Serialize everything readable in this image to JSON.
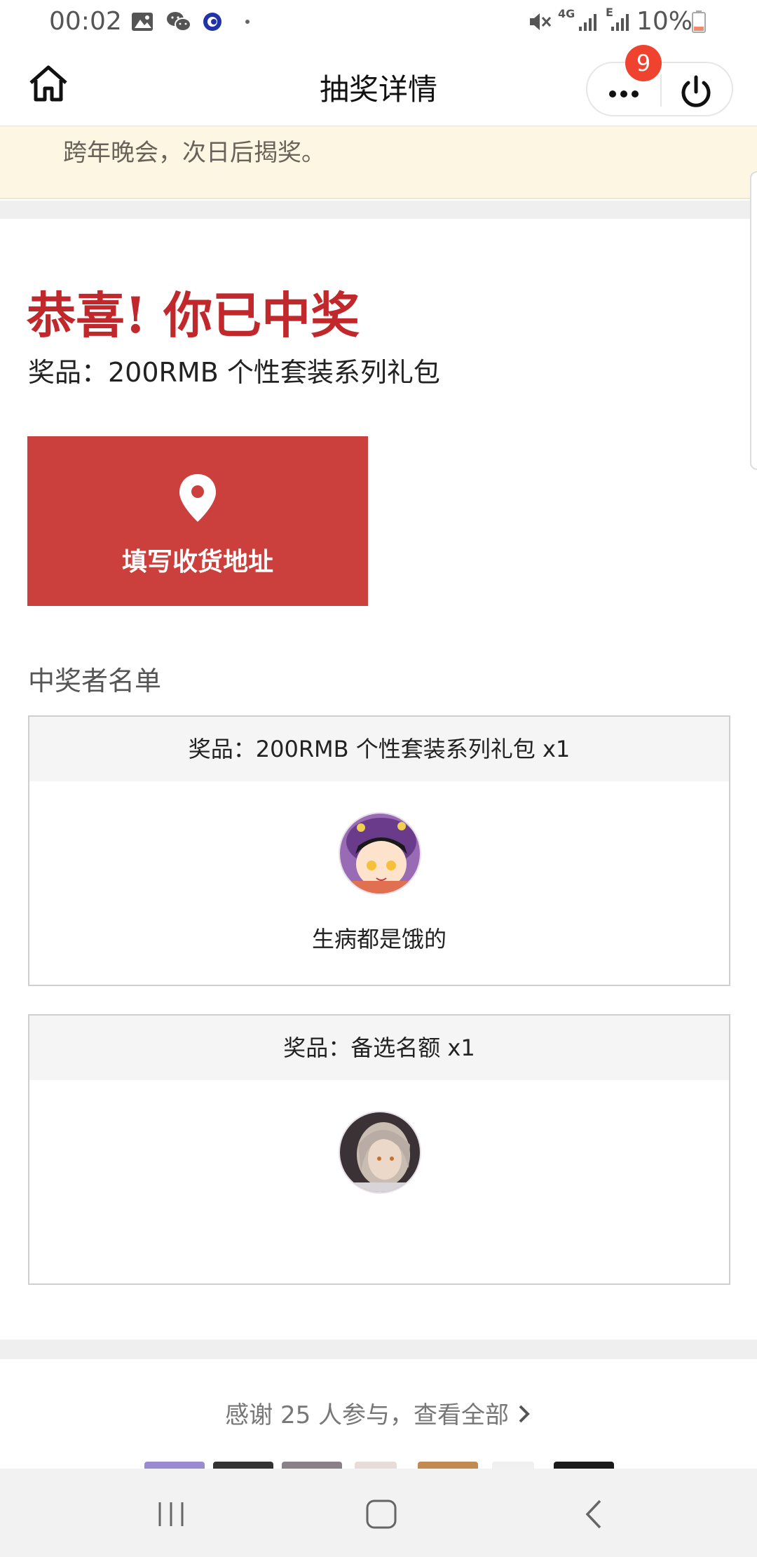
{
  "status_bar": {
    "time": "00:02",
    "network_4g": "4G",
    "network_e": "E",
    "battery": "10%"
  },
  "nav": {
    "title": "抽奖详情",
    "badge_count": "9"
  },
  "notice": {
    "text": "跨年晚会，次日后揭奖。"
  },
  "win": {
    "title": "恭喜! 你已中奖",
    "prize_line": "奖品：200RMB 个性套装系列礼包",
    "address_button_label": "填写收货地址"
  },
  "winners": {
    "section_label": "中奖者名单",
    "cards": [
      {
        "header": "奖品：200RMB 个性套装系列礼包 x1",
        "winner_name": "生病都是饿的"
      },
      {
        "header": "奖品：备选名额 x1",
        "winner_name": ""
      }
    ]
  },
  "participants": {
    "thanks_text": "感谢 25 人参与，查看全部"
  },
  "colors": {
    "accent_red": "#cb3f3d",
    "title_red": "#c0282c",
    "badge_red": "#f0432f",
    "notice_bg": "#fdf6e3"
  },
  "icons": [
    "home-icon",
    "more-icon",
    "power-icon",
    "location-pin-icon",
    "chevron-right-icon",
    "recents-icon",
    "home-nav-icon",
    "back-icon"
  ]
}
